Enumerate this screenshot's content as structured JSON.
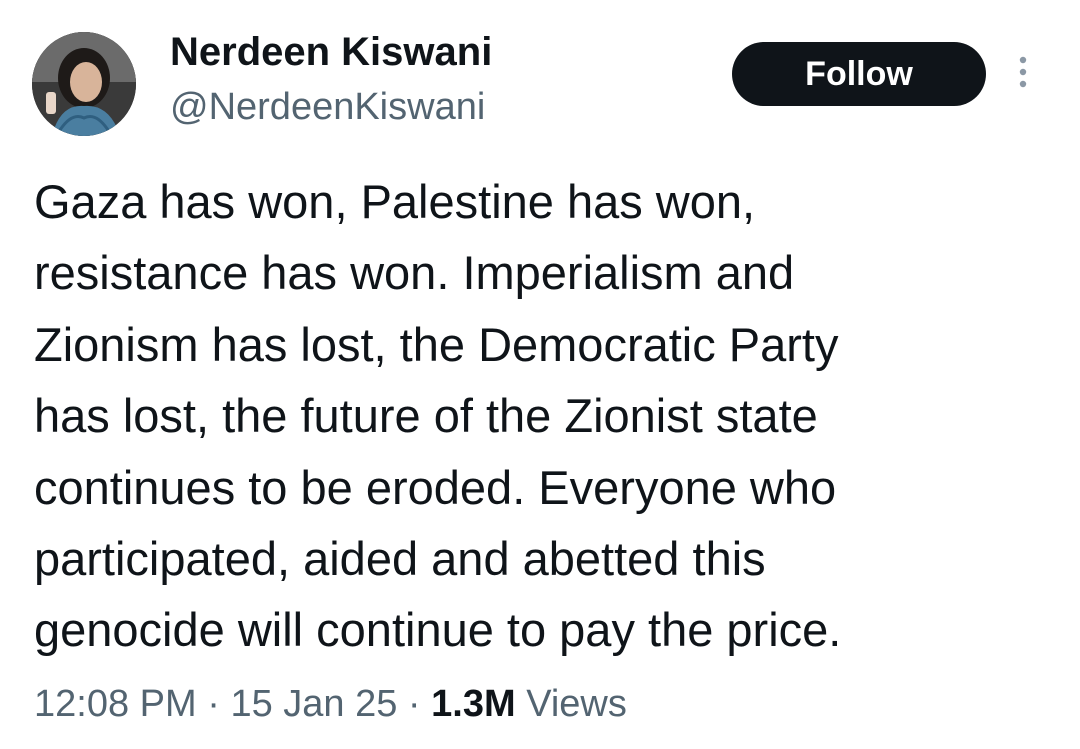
{
  "author": {
    "display_name": "Nerdeen Kiswani",
    "handle": "@NerdeenKiswani",
    "avatar_icon": "profile-photo"
  },
  "actions": {
    "follow_label": "Follow",
    "more_icon": "more-vertical-icon"
  },
  "tweet": {
    "lines": [
      "Gaza has won, Palestine has won,",
      "resistance has won. Imperialism and",
      "Zionism has lost, the Democratic Party",
      "has lost, the future of the Zionist state",
      "continues to be eroded. Everyone who",
      "participated, aided and abetted this",
      "genocide will continue to pay the price."
    ]
  },
  "meta": {
    "time": "12:08 PM",
    "separator": "·",
    "date": "15 Jan 25",
    "views_count": "1.3M",
    "views_label": "Views"
  },
  "colors": {
    "text_primary": "#0f1419",
    "text_secondary": "#536471",
    "button_bg": "#0f1419",
    "button_text": "#ffffff"
  }
}
